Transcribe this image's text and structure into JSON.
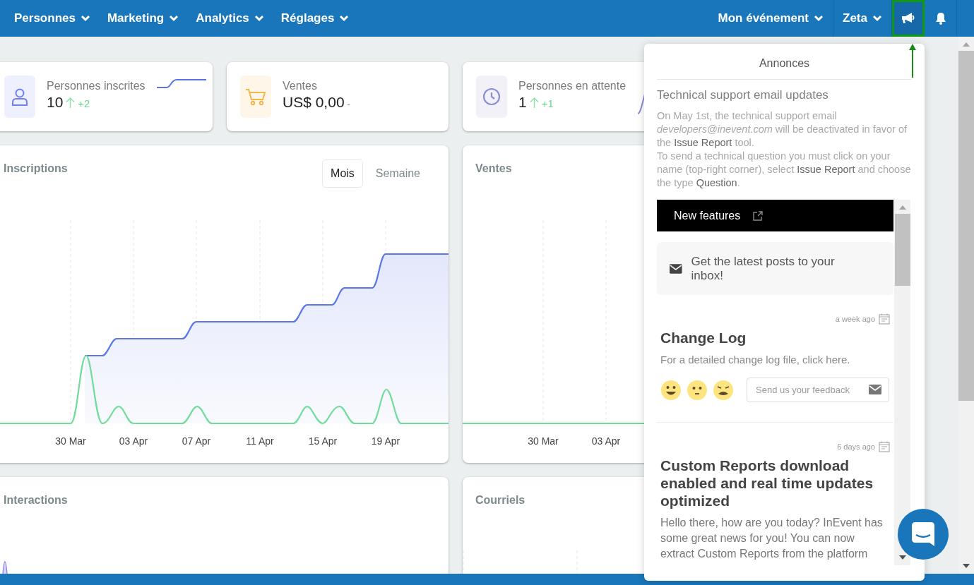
{
  "nav": {
    "left": [
      {
        "label": "Personnes"
      },
      {
        "label": "Marketing"
      },
      {
        "label": "Analytics"
      },
      {
        "label": "Réglages"
      }
    ],
    "right": [
      {
        "label": "Mon événement"
      },
      {
        "label": "Zeta"
      }
    ],
    "icon_buttons": [
      {
        "kind": "megaphone",
        "selected": true,
        "highlighted": true
      },
      {
        "kind": "bell",
        "selected": false,
        "highlighted": false
      }
    ]
  },
  "stats": [
    {
      "kind": "registered",
      "label": "Personnes inscrites",
      "value": "10",
      "increase": true,
      "delta": "+2",
      "sparkline": true
    },
    {
      "kind": "sales",
      "label": "Ventes",
      "value": "US$ 0,00",
      "increase": false,
      "delta": "-",
      "sparkline": false
    },
    {
      "kind": "waiting",
      "label": "Personnes en attente",
      "value": "1",
      "increase": true,
      "delta": "+1",
      "sparkline": true
    }
  ],
  "charts": [
    {
      "kind": "registrations",
      "title": "Inscriptions",
      "tabs": [
        {
          "label": "Mois",
          "selected": true
        },
        {
          "label": "Semaine",
          "selected": false
        }
      ],
      "axis_labels": [
        "30 Mar",
        "03 Apr",
        "07 Apr",
        "11 Apr",
        "15 Apr",
        "19 Apr"
      ]
    },
    {
      "kind": "sales",
      "title": "Ventes",
      "axis_labels": [
        "30 Mar",
        "03 Apr"
      ]
    },
    {
      "kind": "interactions",
      "title": "Interactions"
    },
    {
      "kind": "emails",
      "title": "Courriels"
    }
  ],
  "announcements": {
    "title": "Annonces",
    "heading": "Technical support email updates",
    "paragraphs": [
      "On May 1st, the technical support email *developers@inevent.com* will be deactivated in favor of the **Issue Report** tool.",
      "To send a technical question you must click on your name (top-right corner), select **Issue Report** and choose the type **Question**."
    ],
    "widget": {
      "header": "New features",
      "subscribe": "Get the latest posts to your inbox!",
      "posts": [
        {
          "time": "a week ago",
          "title": "Change Log",
          "body": "For a detailed change log file, click here.",
          "feedback_placeholder": "Send us your feedback"
        },
        {
          "time": "6 days ago",
          "title": "Custom Reports download enabled and real time updates optimized",
          "body": "Hello there, how are you today? InEvent has some great news for you! You can now extract Custom Reports from the platform"
        }
      ]
    }
  }
}
